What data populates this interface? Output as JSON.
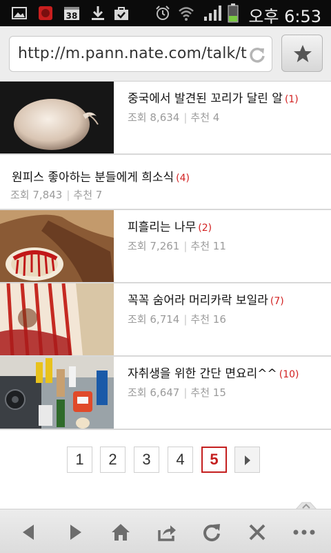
{
  "status_bar": {
    "battery_level": 0.35,
    "time": "오후 6:53",
    "icons": [
      "gallery-icon",
      "app-icon",
      "calendar-icon",
      "download-icon",
      "bag-icon",
      "alarm-icon",
      "wifi-icon",
      "signal-icon",
      "battery-icon"
    ],
    "calendar_badge": "38"
  },
  "browser": {
    "url": "http://m.pann.nate.com/talk/t"
  },
  "posts": [
    {
      "title": "중국에서 발견된 꼬리가 달린 알",
      "comments": "(1)",
      "views_label": "조회",
      "views": "8,634",
      "rec_label": "추천",
      "recs": "4"
    },
    {
      "title": "원피스 좋아하는 분들에게 희소식",
      "comments": "(4)",
      "views_label": "조회",
      "views": "7,843",
      "rec_label": "추천",
      "recs": "7"
    },
    {
      "title": "피흘리는 나무",
      "comments": "(2)",
      "views_label": "조회",
      "views": "7,261",
      "rec_label": "추천",
      "recs": "11"
    },
    {
      "title": "꼭꼭 숨어라 머리카락 보일라",
      "comments": "(7)",
      "views_label": "조회",
      "views": "6,714",
      "rec_label": "추천",
      "recs": "16"
    },
    {
      "title": "자취생을 위한 간단 면요리^^",
      "comments": "(10)",
      "views_label": "조회",
      "views": "6,647",
      "rec_label": "추천",
      "recs": "15"
    }
  ],
  "pagination": {
    "pages": [
      "1",
      "2",
      "3",
      "4",
      "5"
    ],
    "current": "5"
  },
  "colors": {
    "accent_red": "#c41e1e",
    "meta_gray": "#9b9b9b"
  }
}
